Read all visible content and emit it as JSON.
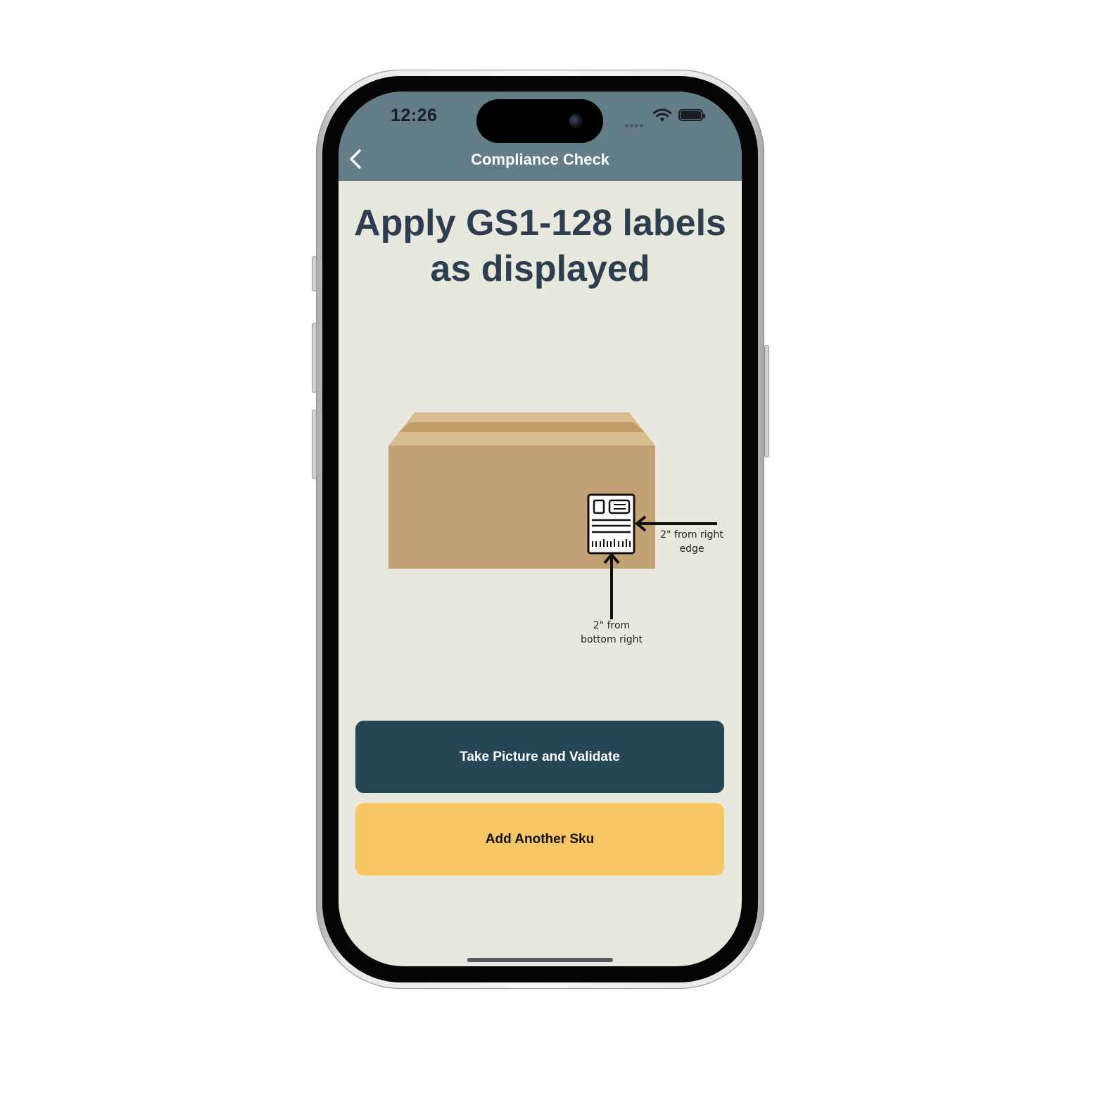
{
  "status_bar": {
    "time": "12:26"
  },
  "nav": {
    "title": "Compliance Check",
    "back_icon": "chevron-left-icon"
  },
  "main": {
    "heading": "Apply GS1-128 labels as displayed",
    "illustration": {
      "right_edge_note_line1": "2\" from right",
      "right_edge_note_line2": "edge",
      "bottom_note_line1": "2\" from",
      "bottom_note_line2": "bottom right"
    }
  },
  "actions": {
    "primary_label": "Take Picture and Validate",
    "secondary_label": "Add Another Sku"
  },
  "colors": {
    "header": "#627c88",
    "background": "#e9e8de",
    "heading": "#2c3e4f",
    "primary_button": "#254654",
    "secondary_button": "#f6c663",
    "box": "#c2a274"
  }
}
